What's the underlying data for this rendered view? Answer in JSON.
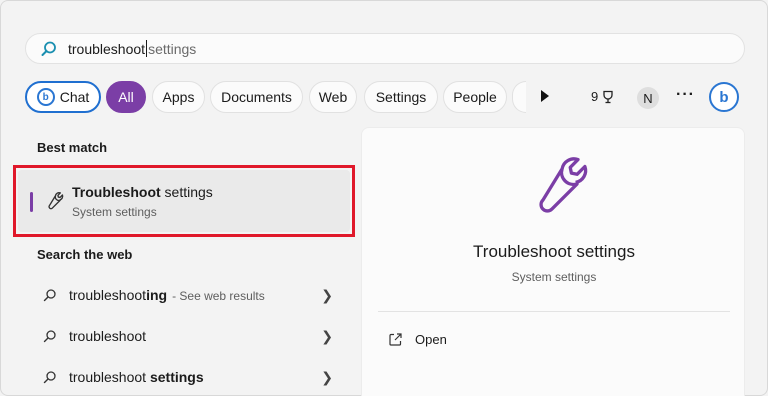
{
  "search": {
    "query_typed": "troubleshoot",
    "query_suggestion": "settings"
  },
  "filters": {
    "chat": "Chat",
    "all": "All",
    "apps": "Apps",
    "documents": "Documents",
    "web": "Web",
    "settings": "Settings",
    "people": "People",
    "points": "9",
    "avatar_initial": "N",
    "more": "···",
    "bing_letter": "b",
    "chat_logo_letter": "b"
  },
  "best_match": {
    "heading": "Best match",
    "title_bold": "Troubleshoot",
    "title_rest": " settings",
    "subtitle": "System settings"
  },
  "web": {
    "heading": "Search the web",
    "items": [
      {
        "prefix": "troubleshoot",
        "bold": "ing",
        "suffix": "",
        "hint": "- See web results"
      },
      {
        "prefix": "troubleshoot",
        "bold": "",
        "suffix": "",
        "hint": ""
      },
      {
        "prefix": "troubleshoot ",
        "bold": "settings",
        "suffix": "",
        "hint": ""
      }
    ]
  },
  "detail": {
    "title": "Troubleshoot settings",
    "subtitle": "System settings",
    "open_label": "Open"
  },
  "colors": {
    "accent_purple": "#7b3ea6",
    "highlight_red": "#e0182a",
    "bing_blue": "#2a76d2"
  }
}
